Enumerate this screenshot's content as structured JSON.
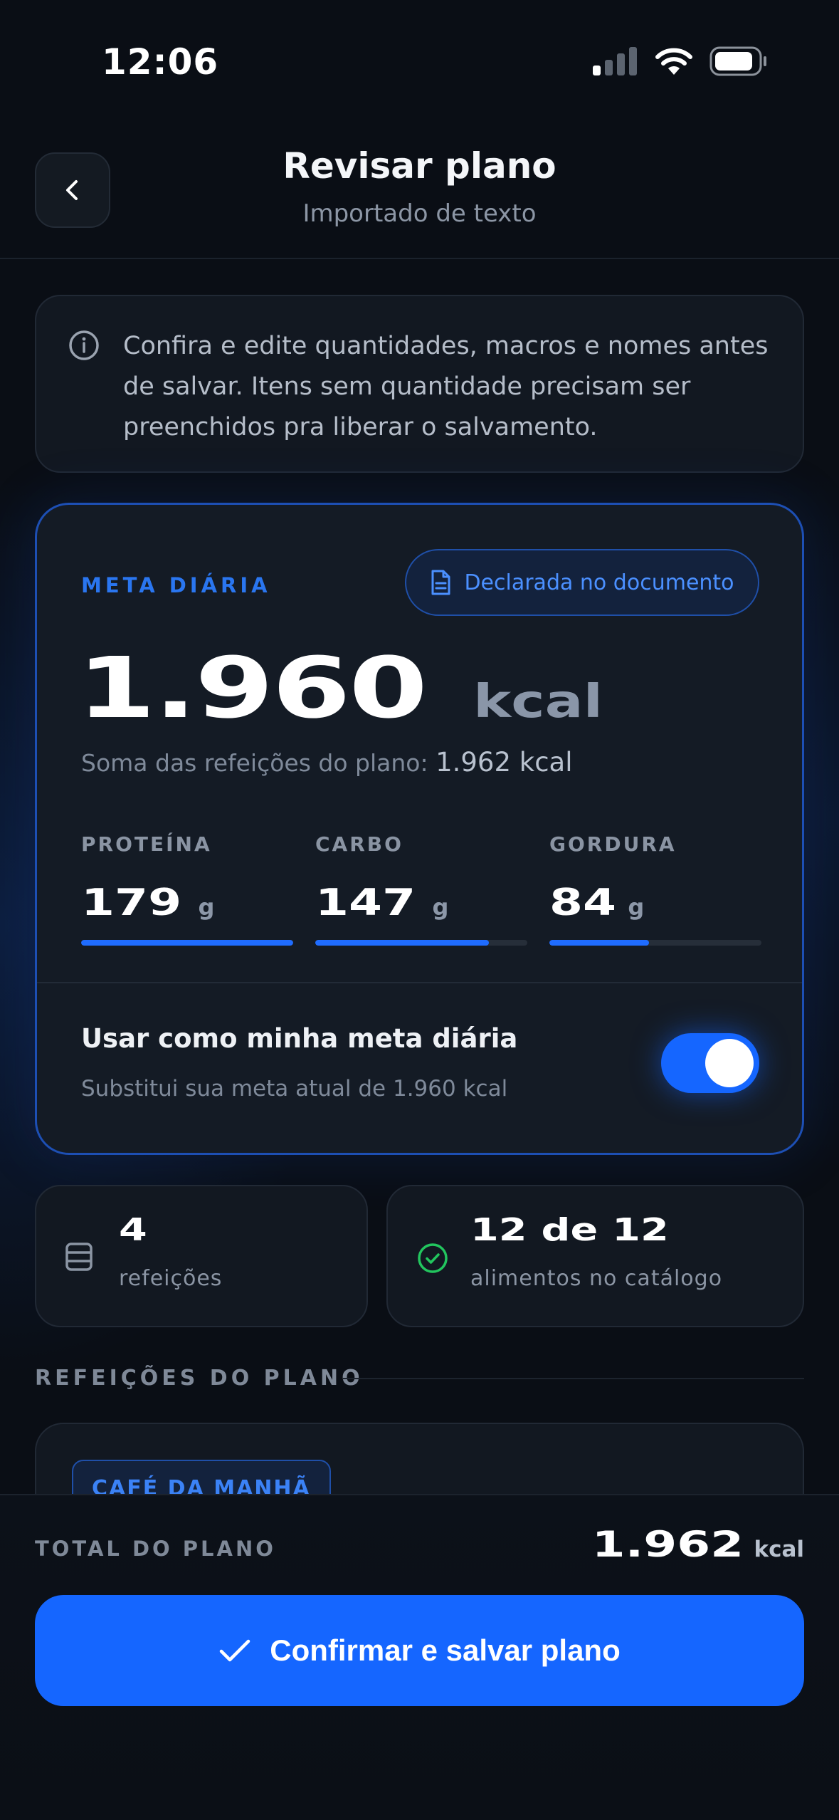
{
  "status_bar": {
    "time": "12:06"
  },
  "header": {
    "title": "Revisar plano",
    "subtitle": "Importado de texto"
  },
  "info": {
    "text": "Confira e edite quantidades, macros e nomes antes de salvar. Itens sem quantidade precisam ser preenchidos pra liberar o salvamento."
  },
  "goal": {
    "label": "META DIÁRIA",
    "badge": "Declarada no documento",
    "kcal_value": "1.960",
    "kcal_unit": "kcal",
    "sum_label": "Soma das refeições do plano:",
    "sum_value": "1.962 kcal",
    "macros": [
      {
        "label": "PROTEÍNA",
        "value": "179",
        "unit": "g",
        "progress": 1.0
      },
      {
        "label": "CARBO",
        "value": "147",
        "unit": "g",
        "progress": 0.82
      },
      {
        "label": "GORDURA",
        "value": "84",
        "unit": "g",
        "progress": 0.47
      }
    ],
    "use_title": "Usar como minha meta diária",
    "use_subtitle": "Substitui sua meta atual de 1.960 kcal",
    "use_enabled": true
  },
  "stats": [
    {
      "value": "4",
      "label": "refeições",
      "icon": "list-icon"
    },
    {
      "value": "12 de 12",
      "label": "alimentos no catálogo",
      "icon": "check-circle-icon"
    }
  ],
  "section": {
    "title": "REFEIÇÕES DO PLANO"
  },
  "meals": [
    {
      "tag": "CAFÉ DA MANHÃ"
    }
  ],
  "footer": {
    "total_label": "TOTAL DO PLANO",
    "total_value": "1.962",
    "total_unit": "kcal",
    "confirm_label": "Confirmar e salvar plano"
  },
  "colors": {
    "accent": "#1566ff",
    "success": "#22c55e",
    "background": "#0a0e15"
  }
}
